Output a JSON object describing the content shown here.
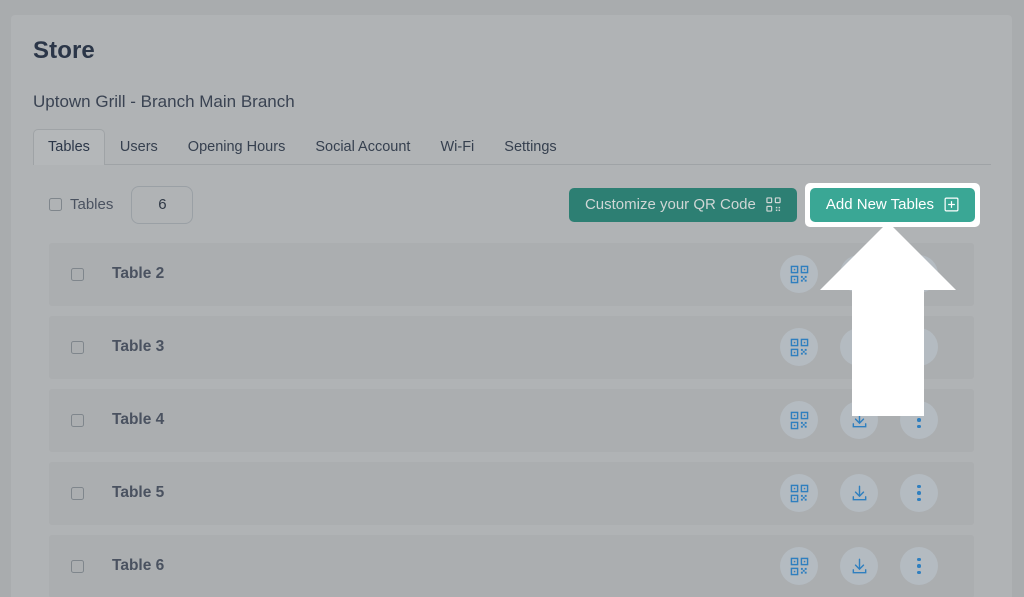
{
  "page": {
    "title": "Store",
    "branch": "Uptown Grill - Branch Main Branch"
  },
  "tabs": [
    {
      "label": "Tables",
      "active": true
    },
    {
      "label": "Users",
      "active": false
    },
    {
      "label": "Opening Hours",
      "active": false
    },
    {
      "label": "Social Account",
      "active": false
    },
    {
      "label": "Wi-Fi",
      "active": false
    },
    {
      "label": "Settings",
      "active": false
    }
  ],
  "toolbar": {
    "select_all_label": "Tables",
    "count_value": "6",
    "customize_qr_label": "Customize your QR Code",
    "customize_qr_icon": "qr-code-icon",
    "add_tables_label": "Add New Tables",
    "add_tables_icon": "plus-square-icon"
  },
  "rows": [
    {
      "label": "Table 2"
    },
    {
      "label": "Table 3"
    },
    {
      "label": "Table 4"
    },
    {
      "label": "Table 5"
    },
    {
      "label": "Table 6"
    }
  ],
  "row_actions": {
    "qr_icon": "qr-code-icon",
    "download_icon": "download-icon",
    "more_icon": "more-vertical-icon"
  },
  "colors": {
    "accent_teal": "#3aa795",
    "accent_teal_dark": "#2d7f73",
    "icon_blue": "#2f7fbf",
    "text_dark": "#2b3648",
    "page_bg": "#b0b3b5",
    "row_bg": "#abaeb0",
    "highlight_ring": "#ffffff"
  },
  "overlay": {
    "arrow_name": "up-arrow-annotation",
    "arrow_color": "#ffffff",
    "points_to": "Add New Tables"
  }
}
